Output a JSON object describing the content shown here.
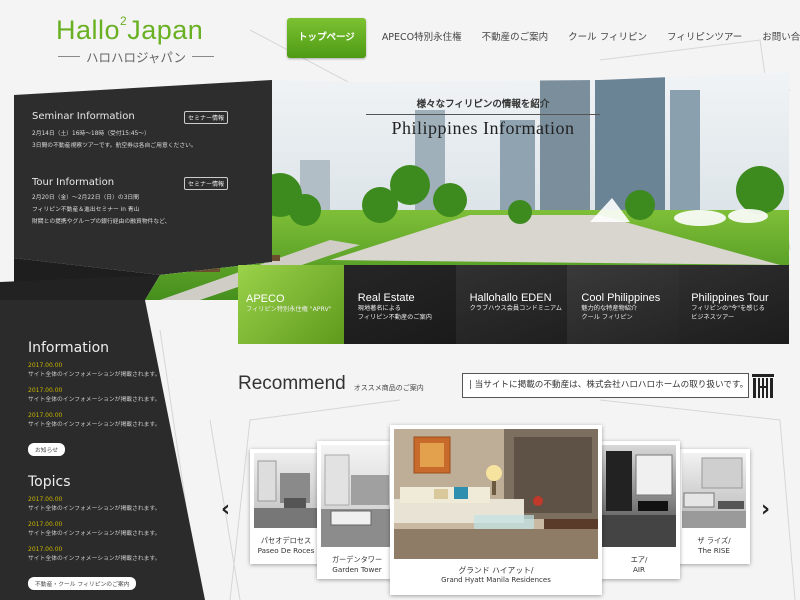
{
  "logo": {
    "main": "Hallo",
    "sup": "2",
    "main2": "Japan",
    "sub": "ハロハロジャパン"
  },
  "nav": {
    "items": [
      {
        "label": "トップページ"
      },
      {
        "label": "APECO特別永住権"
      },
      {
        "label": "不動産のご案内"
      },
      {
        "label": "クール フィリピン"
      },
      {
        "label": "フィリピンツアー"
      },
      {
        "label": "お問い合わせ"
      }
    ]
  },
  "seminar": {
    "title": "Seminar Information",
    "button": "セミナー情報",
    "line1": "2月14日（土）16時〜18時（受付15:45〜）",
    "line2": "3日間の不動産視察ツアーです。航空券は各自ご用意ください。"
  },
  "tour": {
    "title": "Tour Information",
    "button": "セミナー情報",
    "line1": "2月20日（金）〜2月22日（日）の3日間",
    "line2": "フィリピン不動産＆進出セミナー in 青山",
    "line3": "財閥との提携やグループの銀行経由の融資物件など、"
  },
  "information": {
    "title": "Information",
    "items": [
      {
        "date": "2017.00.00",
        "text": "サイト全体のインフォメーションが掲載されます。"
      },
      {
        "date": "2017.00.00",
        "text": "サイト全体のインフォメーションが掲載されます。"
      },
      {
        "date": "2017.00.00",
        "text": "サイト全体のインフォメーションが掲載されます。"
      }
    ],
    "button": "お知らせ"
  },
  "topics": {
    "title": "Topics",
    "items": [
      {
        "date": "2017.00.00",
        "text": "サイト全体のインフォメーションが掲載されます。"
      },
      {
        "date": "2017.00.00",
        "text": "サイト全体のインフォメーションが掲載されます。"
      },
      {
        "date": "2017.00.00",
        "text": "サイト全体のインフォメーションが掲載されます。"
      }
    ],
    "button": "不動産・クール フィリピンのご案内"
  },
  "hero": {
    "subtitle": "様々なフィリピンの情報を紹介",
    "title": "Philippines Information"
  },
  "tiles": [
    {
      "title": "APECO",
      "sub1": "フィリピン特別永住権 \"APRV\"",
      "sub2": ""
    },
    {
      "title": "Real Estate",
      "sub1": "現地著名による",
      "sub2": "フィリピン不動産のご案内"
    },
    {
      "title": "Hallohallo EDEN",
      "sub1": "クラブハウス会員コンドミニアム",
      "sub2": ""
    },
    {
      "title": "Cool Philippines",
      "sub1": "魅力的な特産物紹介",
      "sub2": "クール フィリピン"
    },
    {
      "title": "Philippines Tour",
      "sub1": "フィリピンの\"今\"を感じる",
      "sub2": "ビジネスツアー"
    }
  ],
  "recommend": {
    "title": "Recommend",
    "subtitle": "オススメ商品のご案内",
    "notice": "| 当サイトに掲載の不動産は、株式会社ハロハロホームの取り扱いです。"
  },
  "carousel": {
    "prev": "‹",
    "next": "›",
    "cards": [
      {
        "jp": "パセオデロセス",
        "en": "Paseo De Roces"
      },
      {
        "jp": "ガーデンタワー",
        "en": "Garden Tower"
      },
      {
        "jp": "グランド ハイアット/",
        "en": "Grand Hyatt Manila Residences"
      },
      {
        "jp": "エア/",
        "en": "AIR"
      },
      {
        "jp": "ザ ライズ/",
        "en": "The RISE"
      }
    ]
  },
  "colors": {
    "brand": "#6ab023",
    "dark_panel": "#2b2b2b",
    "date": "#c8b400"
  }
}
